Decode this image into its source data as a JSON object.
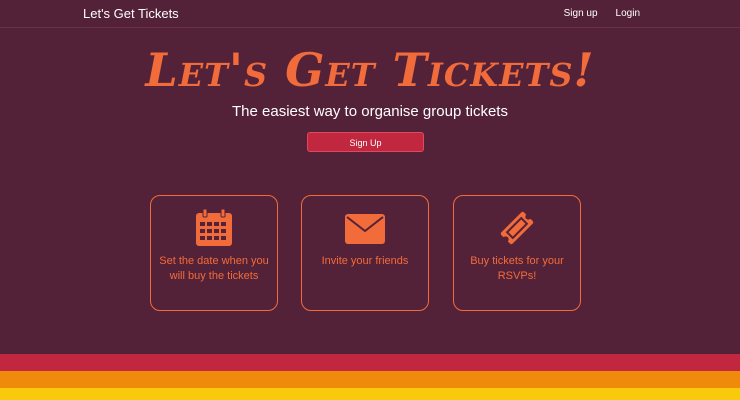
{
  "navbar": {
    "brand": "Let's Get Tickets",
    "links": [
      "Sign up",
      "Login"
    ]
  },
  "hero": {
    "title": "Let's Get Tickets!",
    "subtitle": "The easiest way to organise group tickets",
    "signup_button": "Sign Up"
  },
  "features": [
    {
      "icon": "calendar-icon",
      "text": "Set the date when you will buy the tickets"
    },
    {
      "icon": "envelope-icon",
      "text": "Invite your friends"
    },
    {
      "icon": "ticket-icon",
      "text": "Buy tickets for your RSVPs!"
    }
  ],
  "colors": {
    "background": "#542238",
    "accent": "#f26b3a",
    "button": "#c1273f",
    "stripes": [
      "#c1273f",
      "#ef8a0a",
      "#f9c90c"
    ]
  }
}
